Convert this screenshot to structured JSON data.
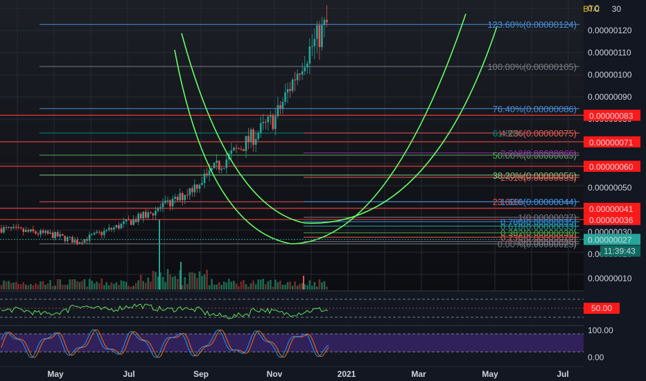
{
  "header": {
    "currency": "BTC",
    "corner_value": "30"
  },
  "colors": {
    "background": "#131722",
    "candle_up": "#26a69a",
    "candle_down": "#ef5350",
    "arc": "#66ff66",
    "rsi_line": "#5ee05e",
    "stoch_k": "#2196f3",
    "stoch_d": "#ff6d00",
    "stoch_band": "#4a2a8a",
    "price_badge": "#26a69a",
    "level_badge": "#ff1a1a"
  },
  "chart_data": {
    "type": "candlestick",
    "symbol_unit": "BTC",
    "y_ticks": [
      "0.0",
      "0.00000120",
      "0.00000110",
      "0.00000100",
      "0.00000090",
      "0.00000080",
      "0.00000050",
      "0.00000030",
      "0.00000020",
      "0.00000010"
    ],
    "x_ticks": [
      "May",
      "Jul",
      "Sep",
      "Nov",
      "2021",
      "Mar",
      "May",
      "Jul"
    ],
    "price_path": [
      [
        "2020-04-01",
        3.3e-07
      ],
      [
        "2020-04-15",
        3.1e-07
      ],
      [
        "2020-04-30",
        2.9e-07
      ],
      [
        "2020-05-10",
        2.6e-07
      ],
      [
        "2020-05-20",
        3e-07
      ],
      [
        "2020-06-05",
        3.7e-07
      ],
      [
        "2020-06-20",
        4.5e-07
      ],
      [
        "2020-07-01",
        5.5e-07
      ],
      [
        "2020-07-15",
        6.8e-07
      ],
      [
        "2020-07-30",
        8.2e-07
      ],
      [
        "2020-08-10",
        1.08e-06
      ],
      [
        "2020-08-20",
        1.24e-06
      ],
      [
        "2020-08-28",
        1.03e-06
      ],
      [
        "2020-09-05",
        8.8e-07
      ],
      [
        "2020-09-15",
        7.5e-07
      ],
      [
        "2020-09-25",
        5.8e-07
      ],
      [
        "2020-10-10",
        5e-07
      ],
      [
        "2020-10-20",
        4.4e-07
      ],
      [
        "2020-11-01",
        3.7e-07
      ],
      [
        "2020-11-10",
        3.1e-07
      ],
      [
        "2020-11-20",
        2.6e-07
      ],
      [
        "2020-11-25",
        3.4e-07
      ],
      [
        "2020-12-05",
        2.9e-07
      ],
      [
        "2020-12-15",
        2.7e-07
      ]
    ],
    "fib_retracement": [
      {
        "label": "123.60%(0.00000124)",
        "value": 1.24e-06,
        "color": "#4a90d9"
      },
      {
        "label": "100.00%(0.00000105)",
        "value": 1.05e-06,
        "color": "#787b86"
      },
      {
        "label": "76.40%(0.00000086)",
        "value": 8.6e-07,
        "color": "#4a90d9"
      },
      {
        "label": "61.80%(0.00000075)",
        "value": 7.5e-07,
        "color": "#00897b"
      },
      {
        "label": "50.00%(0.00000065)",
        "value": 6.5e-07,
        "color": "#4caf50"
      },
      {
        "label": "38.20%(0.00000056)",
        "value": 5.6e-07,
        "color": "#81c784"
      },
      {
        "label": "23.60%(0.00000044)",
        "value": 4.4e-07,
        "color": "#ef5350"
      },
      {
        "label": "0.00%(0.00000025)",
        "value": 2.5e-07,
        "color": "#787b86"
      }
    ],
    "fib_extension": [
      {
        "label": "4.236(0.00000075)",
        "value": 7.5e-07,
        "color": "#ef5350"
      },
      {
        "label": "3.618(0.00000066)",
        "value": 6.6e-07,
        "color": "#9c27b0"
      },
      {
        "label": "2.618(0.00000055)",
        "value": 5.5e-07,
        "color": "#ef5350"
      },
      {
        "label": "1.618(0.00000044)",
        "value": 4.4e-07,
        "color": "#2196f3"
      },
      {
        "label": "1(0.00000037)",
        "value": 3.7e-07,
        "color": "#787b86"
      },
      {
        "label": "0.786(0.00000035)",
        "value": 3.5e-07,
        "color": "#2196f3"
      },
      {
        "label": "0.618(0.00000033)",
        "value": 3.3e-07,
        "color": "#26a69a"
      },
      {
        "label": "0.382(0.00000030)",
        "value": 3e-07,
        "color": "#4caf50"
      },
      {
        "label": "0.236(0.00000028)",
        "value": 2.8e-07,
        "color": "#ef5350"
      },
      {
        "label": "0(0.00000026)",
        "value": 2.6e-07,
        "color": "#787b86"
      }
    ],
    "horizontal_levels": [
      {
        "label": "0.00000083",
        "value": 8.3e-07
      },
      {
        "label": "0.00000071",
        "value": 7.1e-07
      },
      {
        "label": "0.00000060",
        "value": 6e-07
      },
      {
        "label": "0.00000041",
        "value": 4.1e-07
      },
      {
        "label": "0.00000036",
        "value": 3.6e-07
      }
    ],
    "current_price": {
      "label": "0.00000027",
      "value": 2.7e-07,
      "countdown": "11:39:43"
    },
    "rsi": {
      "badge": "50.00",
      "upper": 70,
      "lower": 30
    },
    "stoch_rsi": {
      "ticks": [
        "100.00",
        "0.00"
      ]
    }
  }
}
